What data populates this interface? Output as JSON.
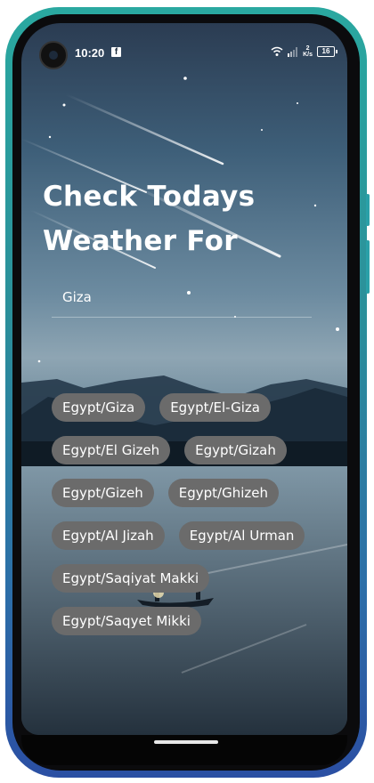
{
  "status_bar": {
    "time": "10:20",
    "notification_icon": "facebook-icon",
    "net_speed_top": "2",
    "net_speed_unit": "K/s",
    "battery": "16"
  },
  "heading": {
    "line1": "Check Todays",
    "line2": "Weather For"
  },
  "search": {
    "value": "Giza"
  },
  "suggestions": [
    [
      "Egypt/Giza",
      "Egypt/El-Giza"
    ],
    [
      "Egypt/El Gizeh",
      "Egypt/Gizah"
    ],
    [
      "Egypt/Gizeh",
      "Egypt/Ghizeh"
    ],
    [
      "Egypt/Al Jizah",
      "Egypt/Al Urman"
    ],
    [
      "Egypt/Saqiyat Makki"
    ],
    [
      "Egypt/Saqyet Mikki"
    ]
  ],
  "colors": {
    "device_frame": "#2aa8a0",
    "chip_background": "#6b6b6b",
    "text": "#ffffff"
  }
}
